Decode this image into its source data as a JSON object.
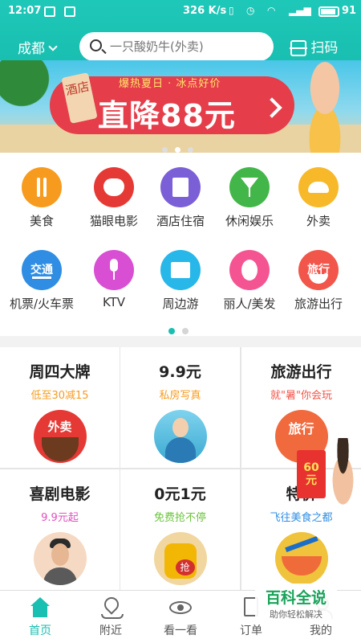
{
  "status_bar": {
    "time": "12:07",
    "speed": "326 K/s",
    "battery": "91"
  },
  "header": {
    "city": "成都",
    "search_placeholder": "一只酸奶牛(外卖)",
    "scan_label": "扫码"
  },
  "banner": {
    "tag": "酒店",
    "subtitle": "爆热夏日 · 冰点好价",
    "headline": "直降88元",
    "active_slide": 1,
    "slide_count": 3
  },
  "categories": [
    {
      "label": "美食",
      "icon": "fork-knife-icon",
      "color": "#f79b1f"
    },
    {
      "label": "猫眼电影",
      "icon": "cat-icon",
      "color": "#e53935"
    },
    {
      "label": "酒店住宿",
      "icon": "hotel-icon",
      "color": "#7b5fd6"
    },
    {
      "label": "休闲娱乐",
      "icon": "cocktail-icon",
      "color": "#43b649"
    },
    {
      "label": "外卖",
      "icon": "kangaroo-icon",
      "color": "#f7b92a"
    },
    {
      "label": "机票/火车票",
      "icon": "plane-icon",
      "color": "#2f8de4",
      "icon_text": "交通"
    },
    {
      "label": "KTV",
      "icon": "mic-icon",
      "color": "#d84fd3"
    },
    {
      "label": "周边游",
      "icon": "landscape-icon",
      "color": "#27b7e8"
    },
    {
      "label": "丽人/美发",
      "icon": "face-icon",
      "color": "#f45592"
    },
    {
      "label": "旅游出行",
      "icon": "watermelon-icon",
      "color": "#f2554a",
      "icon_text": "旅行"
    }
  ],
  "category_pager": {
    "active_page": 1,
    "page_count": 2
  },
  "promos": [
    {
      "title": "周四大牌",
      "subtitle": "低至30减15",
      "subtitle_color": "#f79b1f",
      "badge": "外卖"
    },
    {
      "title": "9.9元",
      "subtitle": "私房写真",
      "subtitle_color": "#f79b1f"
    },
    {
      "title": "旅游出行",
      "subtitle": "就\"暑\"你会玩",
      "subtitle_color": "#f2554a",
      "badge": "旅行"
    },
    {
      "title": "喜剧电影",
      "subtitle": "9.9元起",
      "subtitle_color": "#e14fc0"
    },
    {
      "title": "0元1元",
      "subtitle": "免费抢不停",
      "subtitle_color": "#6cc43c",
      "badge": "抢"
    },
    {
      "title": "特价",
      "subtitle": "飞往美食之都",
      "subtitle_color": "#2f8de4"
    }
  ],
  "red_packet": {
    "amount": "60",
    "unit": "元"
  },
  "bottom_nav": [
    {
      "label": "首页",
      "icon": "home-icon",
      "active": true
    },
    {
      "label": "附近",
      "icon": "location-pin-icon"
    },
    {
      "label": "看一看",
      "icon": "eye-icon"
    },
    {
      "label": "订单",
      "icon": "order-icon"
    },
    {
      "label": "我的",
      "icon": "profile-icon"
    }
  ],
  "watermark": {
    "title": "百科全说",
    "tagline": "助你轻松解决"
  },
  "colors": {
    "brand": "#19bfb0",
    "banner_red": "#e53d4a"
  }
}
